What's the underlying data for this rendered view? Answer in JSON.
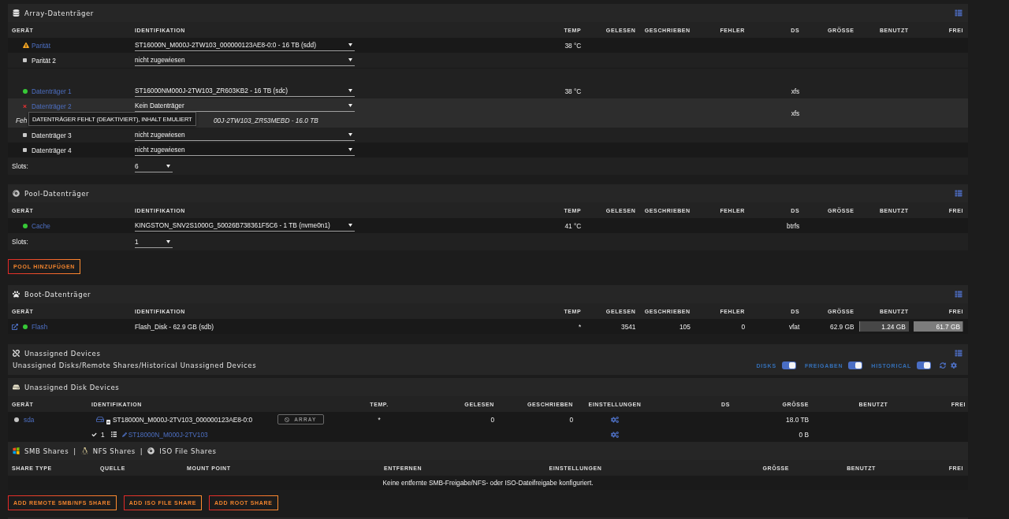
{
  "array": {
    "title": "Array-Datenträger",
    "columns": [
      "GERÄT",
      "IDENTIFIKATION",
      "TEMP",
      "GELESEN",
      "GESCHRIEBEN",
      "FEHLER",
      "DS",
      "GRÖSSE",
      "BENUTZT",
      "FREI"
    ],
    "rows": [
      {
        "kind": "warning",
        "gap_before": false,
        "name": "Parität",
        "identification": "ST16000N_M000J-2TW103_000000123AE8-0:0 - 16 TB (sdd)",
        "temp": "38 °C",
        "hovered": false
      },
      {
        "kind": "unassigned",
        "gap_before": false,
        "name": "Parität 2",
        "identification": "nicht zugewiesen",
        "hovered": false
      },
      {
        "kind": "ok",
        "gap_before": true,
        "name": "Datenträger 1",
        "identification": "ST16000NM000J-2TW103_ZR603KB2 - 16 TB (sdc)",
        "temp": "38 °C",
        "fs": "xfs",
        "hovered": false
      },
      {
        "kind": "missing",
        "gap_before": false,
        "name": "Datenträger 2",
        "identification": "Kein Datenträger",
        "fs": "xfs",
        "hovered": true,
        "note_start": "Feh",
        "note_end": "00J-2TW103_ZR53MEBD - 16.0 TB",
        "tooltip": "DATENTRÄGER FEHLT (DEAKTIVIERT), INHALT EMULIERT"
      },
      {
        "kind": "unassigned",
        "gap_before": false,
        "name": "Datenträger 3",
        "identification": "nicht zugewiesen",
        "hovered": false
      },
      {
        "kind": "unassigned",
        "gap_before": false,
        "name": "Datenträger 4",
        "identification": "nicht zugewiesen",
        "hovered": false
      }
    ],
    "slots": {
      "label": "Slots:",
      "value": "6"
    }
  },
  "pool": {
    "title": "Pool-Datenträger",
    "columns": [
      "GERÄT",
      "IDENTIFIKATION",
      "TEMP",
      "GELESEN",
      "GESCHRIEBEN",
      "FEHLER",
      "DS",
      "GRÖSSE",
      "BENUTZT",
      "FREI"
    ],
    "rows": [
      {
        "kind": "ok",
        "name": "Cache",
        "identification": "KINGSTON_SNV2S1000G_50026B738361F5C6 - 1 TB (nvme0n1)",
        "temp": "41 °C",
        "fs": "btrfs",
        "hovered": false
      }
    ],
    "slots": {
      "label": "Slots:",
      "value": "1"
    },
    "add_button": "POOL HINZUFÜGEN"
  },
  "boot": {
    "title": "Boot-Datenträger",
    "columns": [
      "GERÄT",
      "IDENTIFIKATION",
      "TEMP",
      "GELESEN",
      "GESCHRIEBEN",
      "FEHLER",
      "DS",
      "GRÖSSE",
      "BENUTZT",
      "FREI"
    ],
    "rows": [
      {
        "kind": "ok",
        "name": "Flash",
        "identification": "Flash_Disk - 62.9 GB (sdb)",
        "temp": "*",
        "reads": "3541",
        "writes": "105",
        "errors": "0",
        "fs": "vfat",
        "size": "62.9 GB",
        "used": {
          "text": "1.24 GB",
          "level": 0.02
        },
        "free": {
          "text": "61.7 GB",
          "level": 0.98
        },
        "hovered": false
      }
    ]
  },
  "unassigned": {
    "title": "Unassigned Devices",
    "subtitle": "Unassigned Disks/Remote Shares/Historical Unassigned Devices",
    "toggles": [
      {
        "label": "DISKS",
        "on": true
      },
      {
        "label": "FREIGABEN",
        "on": true
      },
      {
        "label": "HISTORICAL",
        "on": true
      }
    ],
    "disk_devices": {
      "title": "Unassigned Disk Devices",
      "columns": [
        "GERÄT",
        "IDENTIFIKATION",
        "TEMP.",
        "GELESEN",
        "GESCHRIEBEN",
        "EINSTELLUNGEN",
        "DS",
        "GRÖSSE",
        "BENUTZT",
        "FREI"
      ],
      "rows": [
        {
          "kind": "disk",
          "spun_down": true,
          "device": "sda",
          "identification": "ST18000N_M000J-2TV103_000000123AE8-0:0",
          "array_button": {
            "label": "ARRAY",
            "disabled": true
          },
          "temp": "*",
          "reads": "0",
          "writes": "0",
          "size": "18.0 TB"
        },
        {
          "kind": "partition",
          "number": "1",
          "label": "ST18000N_M000J-2TV103",
          "size": "0 B"
        }
      ]
    }
  },
  "shares": {
    "title_parts": [
      "SMB Shares",
      "NFS Shares",
      "ISO File Shares"
    ],
    "separators": [
      "|",
      "|"
    ],
    "columns": [
      "SHARE TYPE",
      "QUELLE",
      "MOUNT POINT",
      "ENTFERNEN",
      "EINSTELLUNGEN",
      "GRÖSSE",
      "BENUTZT",
      "FREI"
    ],
    "empty_message": "Keine entfernte SMB-Freigabe/NFS- oder ISO-Dateifreigabe konfiguriert.",
    "buttons": [
      "ADD REMOTE SMB/NFS SHARE",
      "ADD ISO FILE SHARE",
      "ADD ROOT SHARE"
    ]
  }
}
